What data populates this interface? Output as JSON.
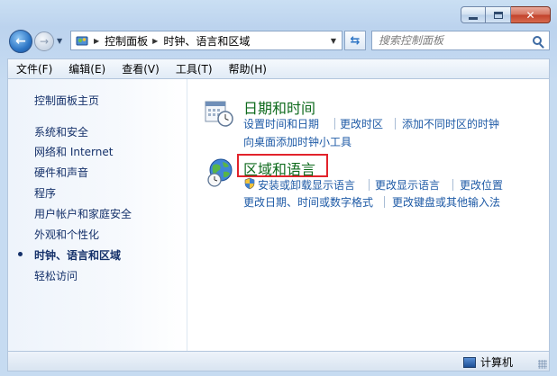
{
  "address": {
    "segments": [
      "控制面板",
      "时钟、语言和区域"
    ]
  },
  "search": {
    "placeholder": "搜索控制面板"
  },
  "menu": [
    "文件(F)",
    "编辑(E)",
    "查看(V)",
    "工具(T)",
    "帮助(H)"
  ],
  "sidebar": {
    "home": "控制面板主页",
    "items": [
      "系统和安全",
      "网络和 Internet",
      "硬件和声音",
      "程序",
      "用户帐户和家庭安全",
      "外观和个性化",
      "时钟、语言和区域",
      "轻松访问"
    ],
    "selected_index": 6
  },
  "categories": [
    {
      "title": "日期和时间",
      "icon": "calendar-clock-icon",
      "links_row1": [
        "设置时间和日期",
        "更改时区",
        "添加不同时区的时钟"
      ],
      "links_row2": [
        "向桌面添加时钟小工具"
      ]
    },
    {
      "title": "区域和语言",
      "icon": "globe-clock-icon",
      "links_row1": [
        "安装或卸载显示语言",
        "更改显示语言",
        "更改位置"
      ],
      "links_row2": [
        "更改日期、时间或数字格式",
        "更改键盘或其他输入法"
      ]
    }
  ],
  "status": {
    "computer": "计算机"
  },
  "colors": {
    "highlight_box": "#e2232b",
    "category_title": "#0e6a1c",
    "link": "#1e5aa6"
  }
}
